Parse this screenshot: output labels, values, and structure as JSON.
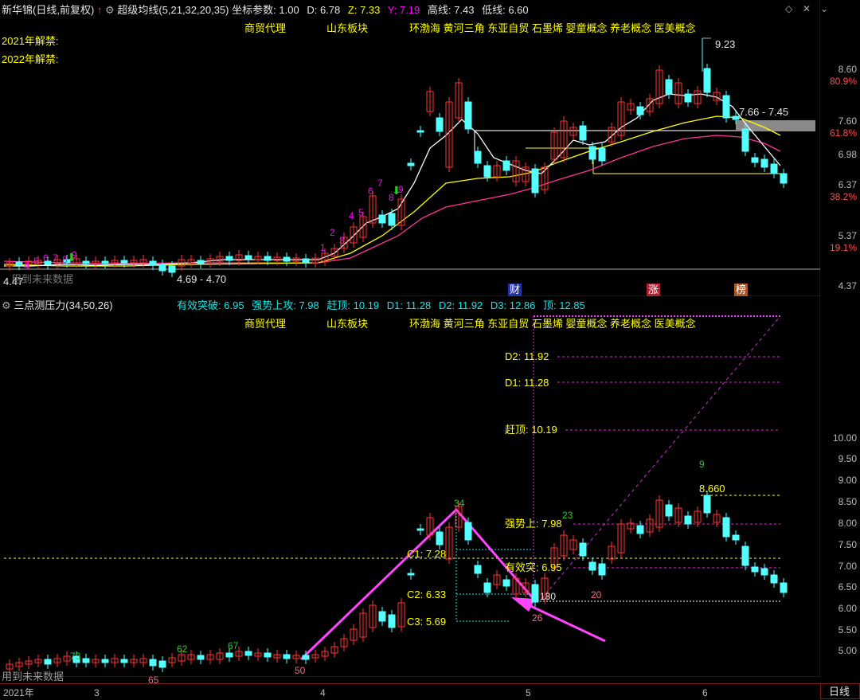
{
  "main": {
    "title": "新华锦(日线,前复权)",
    "up_arrow": "↑",
    "indicator_name": "超级均线(5,21,32,20,35)",
    "coord_label": "坐标参数:",
    "coord_value": "1.00",
    "d_label": "D:",
    "d_value": "6.78",
    "z_label": "Z:",
    "z_value": "7.33",
    "yy_label": "Y:",
    "yy_value": "7.19",
    "high_label": "高线:",
    "high_value": "7.43",
    "low_label": "低线:",
    "low_value": "6.60",
    "concepts": [
      "商贸代理",
      "山东板块",
      "环渤海 黄河三角 东亚自贸 石墨烯 婴童概念 养老概念 医美概念"
    ],
    "lift_2021": "2021年解禁:",
    "lift_2022": "2022年解禁:",
    "peak_label": "9.23",
    "range_label": "7.66 - 7.45",
    "low_range_label": "4.69 - 4.70",
    "left_price": "4.47",
    "future_hint": "用到未来数据",
    "markers": [
      "财",
      "涨",
      "榜"
    ],
    "counts": [
      "1",
      "2",
      "3",
      "4",
      "5",
      "6",
      "7",
      "8",
      "9",
      "4",
      "5",
      "6",
      "7",
      "8",
      "9"
    ],
    "y_axis": [
      {
        "v": "8.60",
        "c": "w"
      },
      {
        "v": "80.9%",
        "c": "r"
      },
      {
        "v": "7.60",
        "c": "w"
      },
      {
        "v": "61.8%",
        "c": "r"
      },
      {
        "v": "6.98",
        "c": "w"
      },
      {
        "v": "6.37",
        "c": "w"
      },
      {
        "v": "38.2%",
        "c": "r"
      },
      {
        "v": "5.37",
        "c": "w"
      },
      {
        "v": "19.1%",
        "c": "r"
      },
      {
        "v": "4.37",
        "c": "w"
      }
    ]
  },
  "sub": {
    "title": "三点测压力(34,50,26)",
    "effective_label": "有效突破:",
    "effective_value": "6.95",
    "strong_label": "强势上攻:",
    "strong_value": "7.98",
    "chase_label": "赶顶:",
    "chase_value": "10.19",
    "d1_label": "D1:",
    "d1_value": "11.28",
    "d2_label": "D2:",
    "d2_value": "11.92",
    "d3_label": "D3:",
    "d3_value": "12.86",
    "top_label": "顶:",
    "top_value": "12.85",
    "concepts": [
      "商贸代理",
      "山东板块",
      "环渤海 黄河三角 东亚自贸 石墨烯 婴童概念 养老概念 医美概念"
    ],
    "levels": {
      "d2": "D2: 11.92",
      "d1": "D1: 11.28",
      "chase": "赶顶: 10.19",
      "strong": "强势上: 7.98",
      "effective": "有效突: 6.95",
      "c1": "C1: 7.28",
      "c2": "C2: 6.33",
      "c3": "C3: 5.69",
      "p8660": "8.660"
    },
    "num_labels": [
      "34",
      "23",
      "9",
      "26",
      "20",
      "180",
      "73",
      "62",
      "67",
      "65",
      "50"
    ],
    "future_hint": "用到未来数据",
    "y_axis": [
      "10.00",
      "9.50",
      "9.00",
      "8.50",
      "8.00",
      "7.50",
      "7.00",
      "6.50",
      "6.00",
      "5.50",
      "5.00"
    ]
  },
  "xaxis": {
    "labels": [
      "2021年",
      "3",
      "4",
      "5",
      "6"
    ],
    "period": "日线"
  },
  "colors": {
    "up": "#ff3333",
    "down": "#54ffff",
    "ma5": "#ffffff",
    "ma21": "#ffff00",
    "ma32": "#ff3399",
    "pink": "#ff33ff"
  }
}
